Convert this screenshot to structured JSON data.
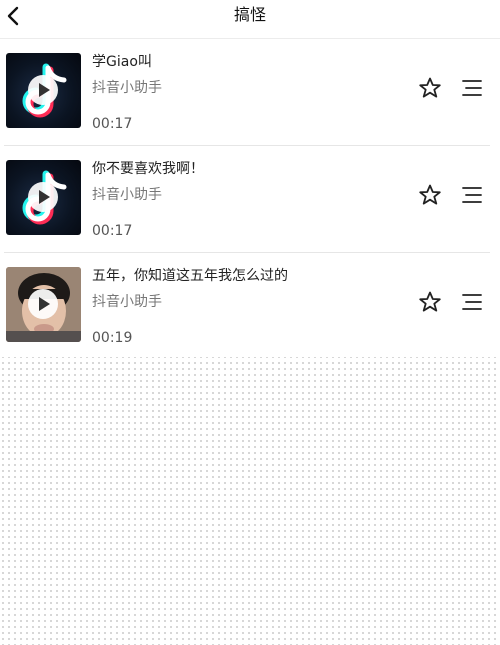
{
  "header": {
    "title": "搞怪"
  },
  "songs": [
    {
      "title": "学Giao叫",
      "artist": "抖音小助手",
      "duration": "00:17",
      "thumb": "tiktok-logo"
    },
    {
      "title": "你不要喜欢我啊！",
      "artist": "抖音小助手",
      "duration": "00:17",
      "thumb": "tiktok-logo"
    },
    {
      "title": "五年，你知道这五年我怎么过的",
      "artist": "抖音小助手",
      "duration": "00:19",
      "thumb": "face-photo"
    }
  ],
  "icons": {
    "back": "chevron-left-icon",
    "favorite": "star-outline-icon",
    "more": "list-menu-icon",
    "play": "play-icon"
  },
  "colors": {
    "accent_cyan": "#25f4ee",
    "accent_pink": "#fe2c55",
    "text_primary": "#222222",
    "text_secondary": "#777777"
  }
}
